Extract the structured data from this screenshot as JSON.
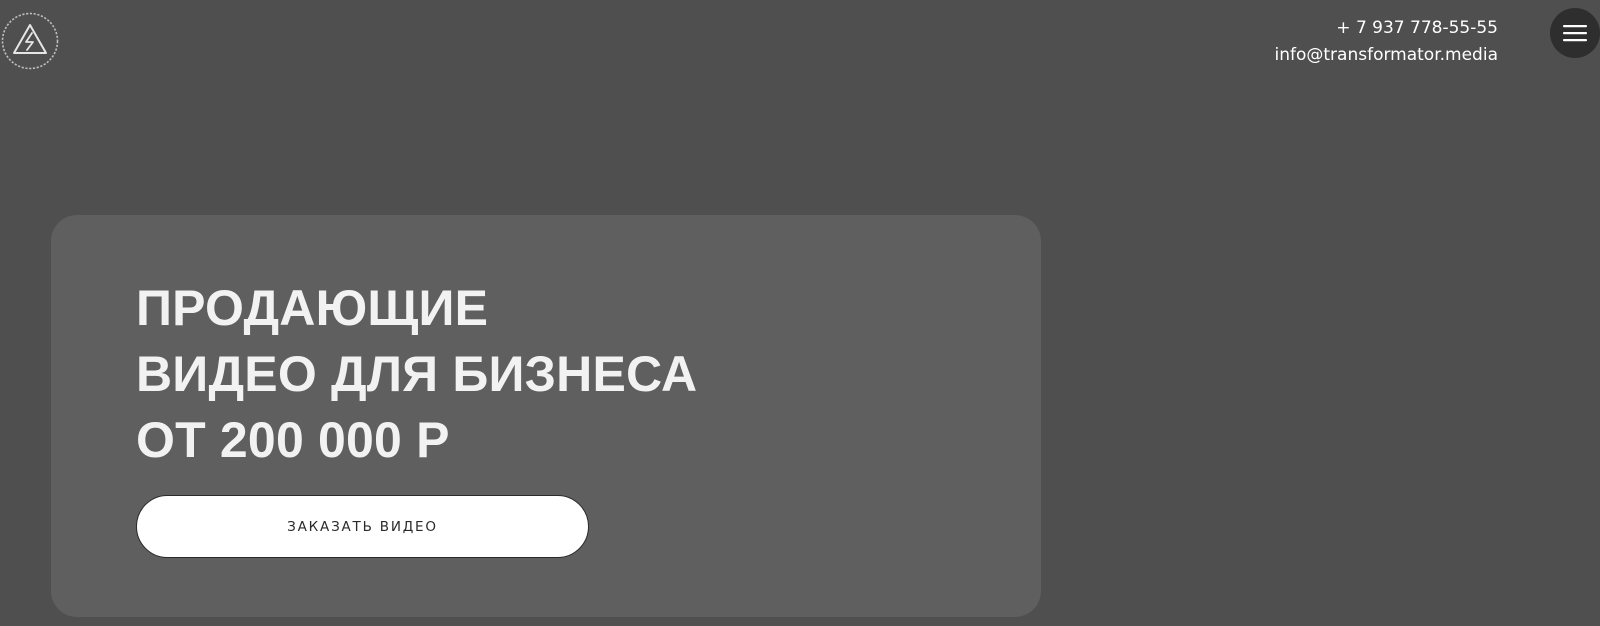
{
  "header": {
    "logo_icon": "lightning-triangle-icon",
    "phone": "+ 7 937 778-55-55",
    "email": "info@transformator.media",
    "menu_icon": "hamburger-menu-icon"
  },
  "hero": {
    "title_lines": [
      "ПРОДАЮЩИЕ",
      "ВИДЕО ДЛЯ БИЗНЕСА",
      "ОТ 200 000 Р"
    ],
    "cta_label": "ЗАКАЗАТЬ ВИДЕО"
  },
  "colors": {
    "background": "#4f4f4f",
    "card": "#5f5f5f",
    "menu_button": "#2e2e2e",
    "cta_background": "#ffffff",
    "cta_text": "#2a2a2a"
  }
}
